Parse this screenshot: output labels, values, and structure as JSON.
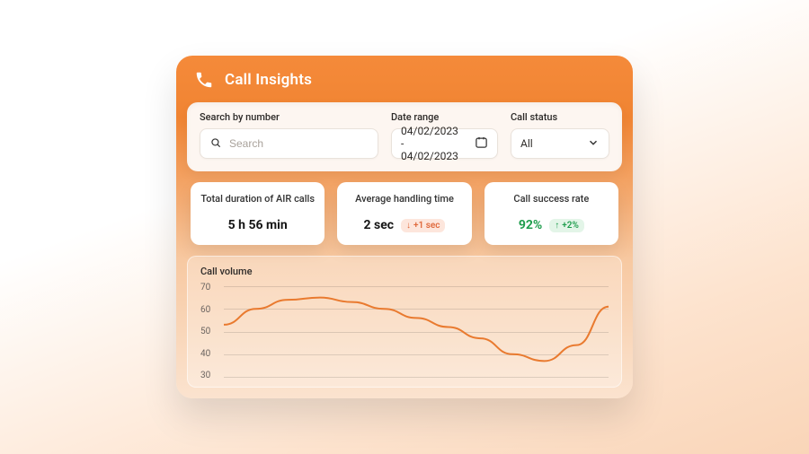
{
  "header": {
    "title": "Call Insights"
  },
  "filters": {
    "search": {
      "label": "Search by number",
      "placeholder": "Search",
      "value": ""
    },
    "date_range": {
      "label": "Date range",
      "value": "04/02/2023 - 04/02/2023"
    },
    "call_status": {
      "label": "Call status",
      "value": "All"
    }
  },
  "stats": {
    "total_duration": {
      "title": "Total duration of AIR calls",
      "value": "5 h 56 min"
    },
    "avg_handling": {
      "title": "Average handling time",
      "value": "2 sec",
      "delta_dir": "down",
      "delta_text": "+1 sec"
    },
    "success_rate": {
      "title": "Call success rate",
      "value": "92%",
      "delta_dir": "up",
      "delta_text": "+2%"
    }
  },
  "chart_data": {
    "type": "line",
    "title": "Call volume",
    "ylabel": "",
    "xlabel": "",
    "y_ticks": [
      "70",
      "60",
      "50",
      "40",
      "30"
    ],
    "ylim": [
      30,
      70
    ],
    "x": [
      0,
      1,
      2,
      3,
      4,
      5,
      6,
      7,
      8,
      9,
      10,
      11,
      12
    ],
    "values": [
      53,
      60,
      64,
      65,
      63,
      60,
      56,
      52,
      47,
      40,
      37,
      44,
      61
    ]
  },
  "colors": {
    "accent": "#e97a2f",
    "success": "#1f9d4d",
    "warn": "#e06a3d"
  }
}
